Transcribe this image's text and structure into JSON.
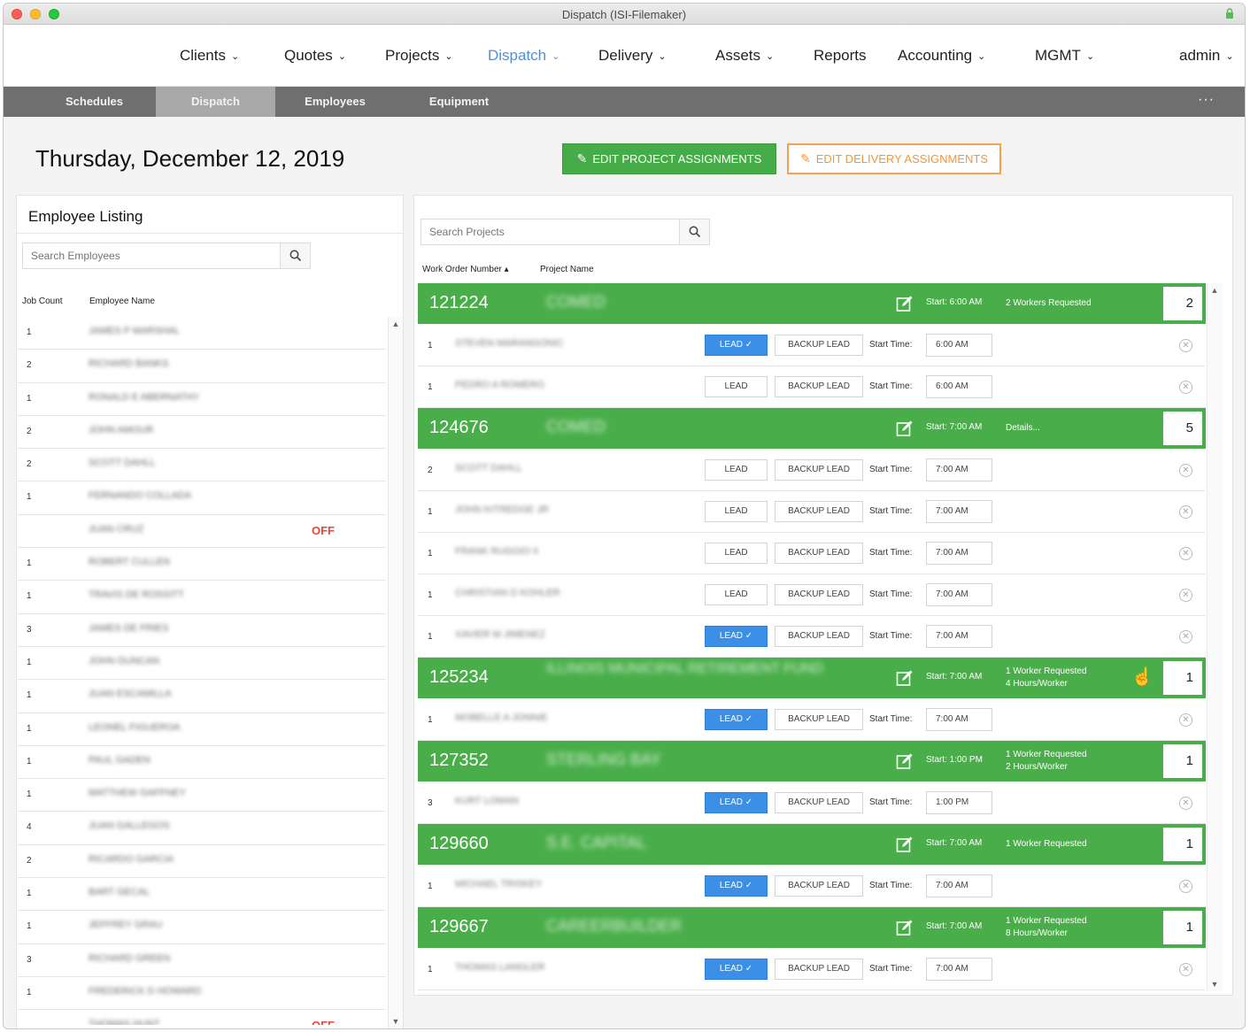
{
  "window": {
    "title": "Dispatch (ISI-Filemaker)"
  },
  "nav": {
    "items": [
      {
        "label": "Clients",
        "chevron": true
      },
      {
        "label": "Quotes",
        "chevron": true
      },
      {
        "label": "Projects",
        "chevron": true
      },
      {
        "label": "Dispatch",
        "chevron": true,
        "active": true
      },
      {
        "label": "Delivery",
        "chevron": true
      },
      {
        "label": "Assets",
        "chevron": true
      },
      {
        "label": "Reports",
        "chevron": false
      },
      {
        "label": "Accounting",
        "chevron": true
      },
      {
        "label": "MGMT",
        "chevron": true
      },
      {
        "label": "admin",
        "chevron": true
      }
    ],
    "accent": "#4a90e2"
  },
  "subnav": {
    "items": [
      {
        "label": "Schedules"
      },
      {
        "label": "Dispatch",
        "active": true
      },
      {
        "label": "Employees"
      },
      {
        "label": "Equipment"
      }
    ],
    "more": "···"
  },
  "header": {
    "date": "Thursday, December 12, 2019",
    "edit_project_label": "EDIT PROJECT ASSIGNMENTS",
    "edit_delivery_label": "EDIT DELIVERY ASSIGNMENTS"
  },
  "employees": {
    "title": "Employee Listing",
    "search_placeholder": "Search Employees",
    "col_job_count": "Job Count",
    "col_name": "Employee Name",
    "rows": [
      {
        "count": "1",
        "name": "JAMES P MARSHAL",
        "off": ""
      },
      {
        "count": "2",
        "name": "RICHARD BANKS",
        "off": ""
      },
      {
        "count": "1",
        "name": "RONALD E ABERNATHY",
        "off": ""
      },
      {
        "count": "2",
        "name": "JOHN AMOUR",
        "off": ""
      },
      {
        "count": "2",
        "name": "SCOTT DAHLL",
        "off": ""
      },
      {
        "count": "1",
        "name": "FERNANDO COLLADA",
        "off": ""
      },
      {
        "count": "",
        "name": "JUAN CRUZ",
        "off": "OFF"
      },
      {
        "count": "1",
        "name": "ROBERT CULLEN",
        "off": ""
      },
      {
        "count": "1",
        "name": "TRAVIS DE ROSSITT",
        "off": ""
      },
      {
        "count": "3",
        "name": "JAMES DE FRIES",
        "off": ""
      },
      {
        "count": "1",
        "name": "JOHN DUNCAN",
        "off": ""
      },
      {
        "count": "1",
        "name": "JUAN ESCAMILLA",
        "off": ""
      },
      {
        "count": "1",
        "name": "LEONEL FIGUEROA",
        "off": ""
      },
      {
        "count": "1",
        "name": "PAUL GADEN",
        "off": ""
      },
      {
        "count": "1",
        "name": "MATTHEW GAFFNEY",
        "off": ""
      },
      {
        "count": "4",
        "name": "JUAN GALLEGOS",
        "off": ""
      },
      {
        "count": "2",
        "name": "RICARDO GARCIA",
        "off": ""
      },
      {
        "count": "1",
        "name": "BART GECAL",
        "off": ""
      },
      {
        "count": "1",
        "name": "JEFFREY GRAU",
        "off": ""
      },
      {
        "count": "3",
        "name": "RICHARD GREEN",
        "off": ""
      },
      {
        "count": "1",
        "name": "FREDERICK D HOWARD",
        "off": ""
      },
      {
        "count": "",
        "name": "THOMAS HUNT",
        "off": "OFF"
      }
    ]
  },
  "projects": {
    "search_placeholder": "Search Projects",
    "col_work_order": "Work Order Number ▴",
    "col_project_name": "Project Name",
    "start_label": "Start Time:",
    "lead_label": "LEAD",
    "backup_label": "BACKUP LEAD",
    "remove_glyph": "✕",
    "groups": [
      {
        "number": "121224",
        "name": "COMED",
        "start": "Start: 6:00 AM",
        "info": [
          "2 Workers Requested"
        ],
        "count": "2",
        "pointer": false,
        "assignments": [
          {
            "count": "1",
            "name": "STEVEN MARANGONIC",
            "lead": true,
            "time": "6:00 AM"
          },
          {
            "count": "1",
            "name": "PEDRO A ROMERO",
            "lead": false,
            "time": "6:00 AM"
          }
        ]
      },
      {
        "number": "124676",
        "name": "COMED",
        "start": "Start: 7:00 AM",
        "info": [
          "Details..."
        ],
        "count": "5",
        "pointer": false,
        "assignments": [
          {
            "count": "2",
            "name": "SCOTT DAHLL",
            "lead": false,
            "time": "7:00 AM"
          },
          {
            "count": "1",
            "name": "JOHN KITREDGE JR",
            "lead": false,
            "time": "7:00 AM"
          },
          {
            "count": "1",
            "name": "FRANK RUGGIO II",
            "lead": false,
            "time": "7:00 AM"
          },
          {
            "count": "1",
            "name": "CHRISTIAN D KOHLER",
            "lead": false,
            "time": "7:00 AM"
          },
          {
            "count": "1",
            "name": "XAVIER M JIMENEZ",
            "lead": true,
            "time": "7:00 AM"
          }
        ]
      },
      {
        "number": "125234",
        "name": "ILLINOIS MUNICIPAL RETIREMENT FUND",
        "start": "Start: 7:00 AM",
        "info": [
          "1 Worker Requested",
          "4 Hours/Worker"
        ],
        "count": "1",
        "pointer": true,
        "assignments": [
          {
            "count": "1",
            "name": "MOBELLE A JONNIE",
            "lead": true,
            "time": "7:00 AM"
          }
        ]
      },
      {
        "number": "127352",
        "name": "STERLING BAY",
        "start": "Start: 1:00 PM",
        "info": [
          "1 Worker Requested",
          "2 Hours/Worker"
        ],
        "count": "1",
        "pointer": false,
        "assignments": [
          {
            "count": "3",
            "name": "KURT LOMAN",
            "lead": true,
            "time": "1:00 PM"
          }
        ]
      },
      {
        "number": "129660",
        "name": "S.E. CAPITAL",
        "start": "Start: 7:00 AM",
        "info": [
          "1 Worker Requested"
        ],
        "count": "1",
        "pointer": false,
        "assignments": [
          {
            "count": "1",
            "name": "MICHAEL TRISKEY",
            "lead": true,
            "time": "7:00 AM"
          }
        ]
      },
      {
        "number": "129667",
        "name": "CAREERBUILDER",
        "start": "Start: 7:00 AM",
        "info": [
          "1 Worker Requested",
          "8 Hours/Worker"
        ],
        "count": "1",
        "pointer": false,
        "assignments": [
          {
            "count": "1",
            "name": "THOMAS LANGLER",
            "lead": true,
            "time": "7:00 AM"
          }
        ]
      }
    ]
  },
  "colors": {
    "green": "#49ae49",
    "blue": "#3b8fe6",
    "orange": "#f3953c",
    "off_red": "#f24236"
  }
}
